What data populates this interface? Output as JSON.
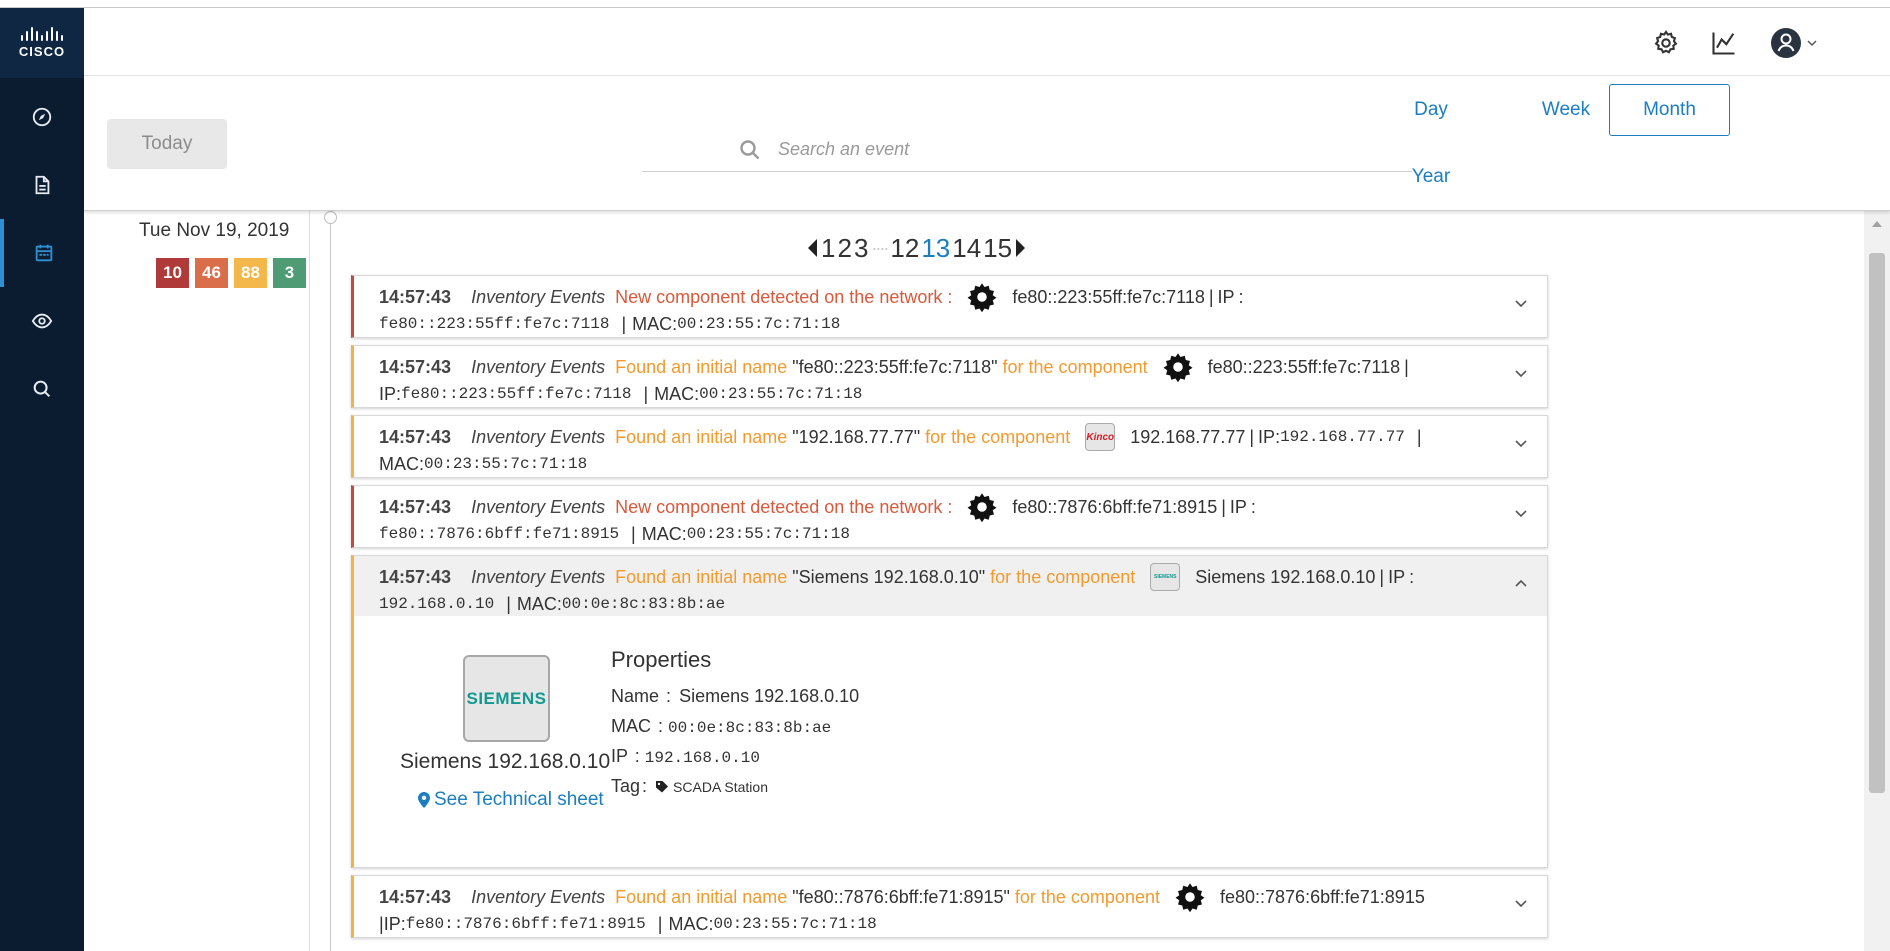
{
  "logo": {
    "text": "CISCO"
  },
  "sidebar": {
    "items": [
      {
        "name": "explore",
        "icon": "compass-icon"
      },
      {
        "name": "reports",
        "icon": "document-icon"
      },
      {
        "name": "events",
        "icon": "calendar-icon",
        "active": true
      },
      {
        "name": "monitor",
        "icon": "eye-icon"
      },
      {
        "name": "search",
        "icon": "search-icon"
      }
    ]
  },
  "header": {
    "icons": [
      "gear-icon",
      "chart-icon",
      "user-icon",
      "chevron-down-icon"
    ]
  },
  "toolbar": {
    "today_label": "Today",
    "search_placeholder": "Search an event",
    "periods": {
      "day": "Day",
      "week": "Week",
      "month": "Month",
      "year": "Year"
    },
    "active_period": "Month"
  },
  "timeline": {
    "date": "Tue Nov 19, 2019",
    "badges": [
      {
        "value": "10",
        "color": "#b0393a"
      },
      {
        "value": "46",
        "color": "#db6e4a"
      },
      {
        "value": "88",
        "color": "#f4b84a"
      },
      {
        "value": "3",
        "color": "#4f9b74"
      }
    ]
  },
  "pagination": {
    "pages": [
      "1",
      "2",
      "3",
      "12",
      "13",
      "14",
      "15"
    ],
    "ellipsis": "····",
    "current": "13"
  },
  "common": {
    "pipe": "|",
    "ip_label": "IP",
    "mac_label": "MAC",
    "colon": ":"
  },
  "events": [
    {
      "time": "14:57:43",
      "category": "Inventory Events",
      "message": "New component detected on the network :",
      "component": "fe80::223:55ff:fe7c:7118",
      "ip": "fe80::223:55ff:fe7c:7118",
      "mac": "00:23:55:7c:71:18"
    },
    {
      "time": "14:57:43",
      "category": "Inventory Events",
      "message": "Found an initial name",
      "quoted": "\"fe80::223:55ff:fe7c:7118\"",
      "message2": "for the component",
      "component": "fe80::223:55ff:fe7c:7118",
      "ip": "fe80::223:55ff:fe7c:7118",
      "mac": "00:23:55:7c:71:18"
    },
    {
      "time": "14:57:43",
      "category": "Inventory Events",
      "message": "Found an initial name",
      "quoted": "\"192.168.77.77\"",
      "message2": "for the component",
      "component": "192.168.77.77",
      "ip": "192.168.77.77",
      "mac": "00:23:55:7c:71:18",
      "logo": "Kinco"
    },
    {
      "time": "14:57:43",
      "category": "Inventory Events",
      "message": "New component detected on the network :",
      "component": "fe80::7876:6bff:fe71:8915",
      "ip": "fe80::7876:6bff:fe71:8915",
      "mac": "00:23:55:7c:71:18"
    },
    {
      "time": "14:57:43",
      "category": "Inventory Events",
      "message": "Found an initial name",
      "quoted": "\"Siemens 192.168.0.10\"",
      "message2": "for the component",
      "component": "Siemens 192.168.0.10",
      "ip": "192.168.0.10",
      "mac": "00:0e:8c:83:8b:ae",
      "logo": "SIEMENS",
      "details": {
        "device_name": "Siemens 192.168.0.10",
        "tech_sheet": "See Technical sheet",
        "properties_title": "Properties",
        "name_label": "Name",
        "name": "Siemens 192.168.0.10",
        "tag_label": "Tag",
        "tag": "SCADA Station"
      }
    },
    {
      "time": "14:57:43",
      "category": "Inventory Events",
      "message": "Found an initial name",
      "quoted": "\"fe80::7876:6bff:fe71:8915\"",
      "message2": "for the component",
      "component": "fe80::7876:6bff:fe71:8915",
      "ip": "fe80::7876:6bff:fe71:8915",
      "mac": "00:23:55:7c:71:18"
    }
  ]
}
